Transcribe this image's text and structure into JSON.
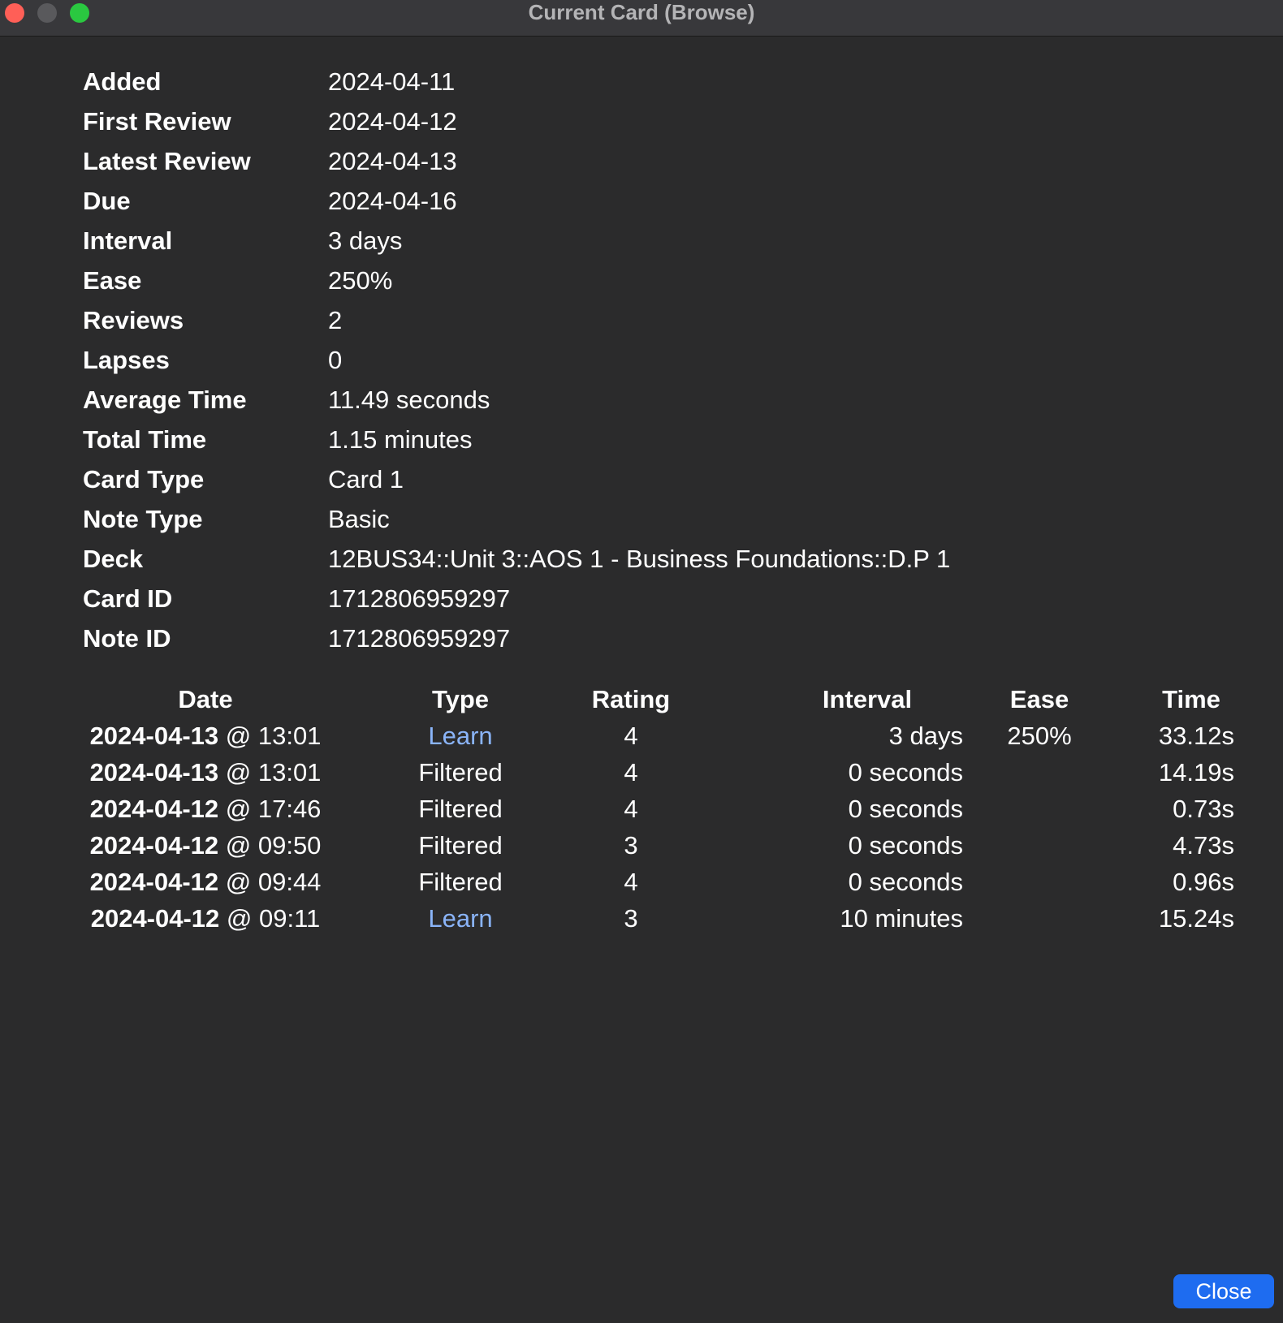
{
  "window": {
    "title": "Current Card (Browse)"
  },
  "card_info": [
    {
      "label": "Added",
      "value": "2024-04-11"
    },
    {
      "label": "First Review",
      "value": "2024-04-12"
    },
    {
      "label": "Latest Review",
      "value": "2024-04-13"
    },
    {
      "label": "Due",
      "value": "2024-04-16"
    },
    {
      "label": "Interval",
      "value": "3 days"
    },
    {
      "label": "Ease",
      "value": "250%"
    },
    {
      "label": "Reviews",
      "value": "2"
    },
    {
      "label": "Lapses",
      "value": "0"
    },
    {
      "label": "Average Time",
      "value": "11.49 seconds"
    },
    {
      "label": "Total Time",
      "value": "1.15 minutes"
    },
    {
      "label": "Card Type",
      "value": "Card 1"
    },
    {
      "label": "Note Type",
      "value": "Basic"
    },
    {
      "label": "Deck",
      "value": "12BUS34::Unit 3::AOS 1 - Business Foundations::D.P 1"
    },
    {
      "label": "Card ID",
      "value": "1712806959297"
    },
    {
      "label": "Note ID",
      "value": "1712806959297"
    }
  ],
  "history": {
    "headers": [
      "Date",
      "Type",
      "Rating",
      "Interval",
      "Ease",
      "Time"
    ],
    "rows": [
      {
        "date": "2024-04-13",
        "time_of_day": "@ 13:01",
        "type": "Learn",
        "rating": "4",
        "interval": "3 days",
        "ease": "250%",
        "time": "33.12s"
      },
      {
        "date": "2024-04-13",
        "time_of_day": "@ 13:01",
        "type": "Filtered",
        "rating": "4",
        "interval": "0 seconds",
        "ease": "",
        "time": "14.19s"
      },
      {
        "date": "2024-04-12",
        "time_of_day": "@ 17:46",
        "type": "Filtered",
        "rating": "4",
        "interval": "0 seconds",
        "ease": "",
        "time": "0.73s"
      },
      {
        "date": "2024-04-12",
        "time_of_day": "@ 09:50",
        "type": "Filtered",
        "rating": "3",
        "interval": "0 seconds",
        "ease": "",
        "time": "4.73s"
      },
      {
        "date": "2024-04-12",
        "time_of_day": "@ 09:44",
        "type": "Filtered",
        "rating": "4",
        "interval": "0 seconds",
        "ease": "",
        "time": "0.96s"
      },
      {
        "date": "2024-04-12",
        "time_of_day": "@ 09:11",
        "type": "Learn",
        "rating": "3",
        "interval": "10 minutes",
        "ease": "",
        "time": "15.24s"
      }
    ]
  },
  "footer": {
    "close_label": "Close"
  },
  "colors": {
    "learn": "#8ab4f8",
    "button": "#1e6cf0",
    "background": "#2b2b2c"
  }
}
